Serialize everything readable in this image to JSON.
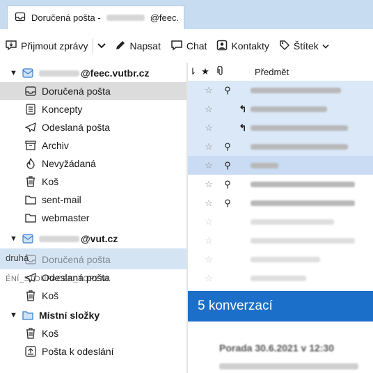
{
  "tab": {
    "title_prefix": "Doručená pošta - ",
    "title_suffix": "@feec."
  },
  "toolbar": {
    "get_mail": "Přijmout zprávy",
    "compose": "Napsat",
    "chat": "Chat",
    "contacts": "Kontakty",
    "tag": "Štítek"
  },
  "sidebar": {
    "account1": {
      "suffix": "@feec.vutbr.cz"
    },
    "folders1": [
      "Doručená pošta",
      "Koncepty",
      "Odeslaná pošta",
      "Archiv",
      "Nevyžádaná",
      "Koš",
      "sent-mail",
      "webmaster"
    ],
    "account2": {
      "suffix": "@vut.cz"
    },
    "folders2": [
      "Doručená pošta",
      "Odeslaná pošta",
      "Koš"
    ],
    "local": {
      "label": "Místní složky"
    },
    "folders3": [
      "Koš",
      "Pošta k odeslání"
    ],
    "drag_ghost": "druhá",
    "drag_ghost2": "ÉNÍ_STOUPACEK_TOPENI"
  },
  "list": {
    "subject_header": "Předmět"
  },
  "banner": {
    "text": "5 konverzací"
  },
  "preview": {
    "title": "Porada 30.6.2021 v 12:30"
  },
  "colors": {
    "accent": "#1b6fc9",
    "tabbar": "#c7dcf0",
    "selection": "#dcdcdc"
  }
}
